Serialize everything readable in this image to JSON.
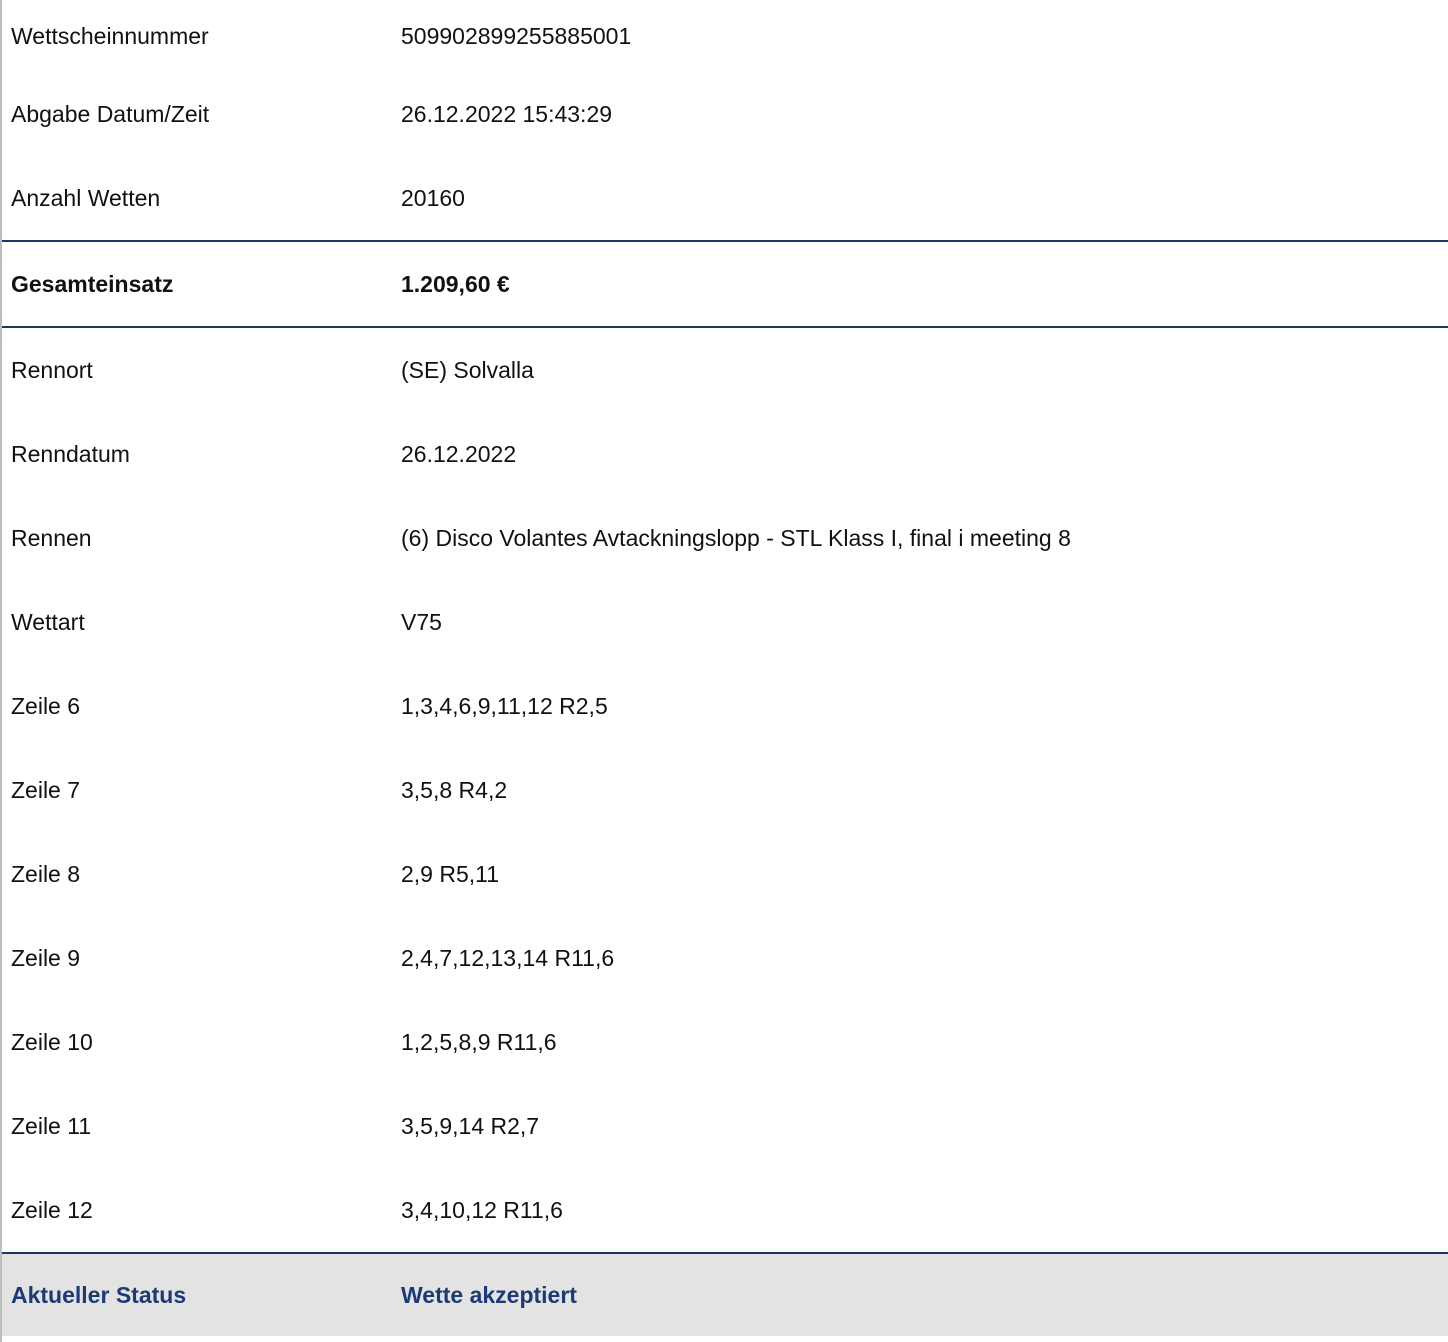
{
  "header_rows": [
    {
      "label": "Wettscheinnummer",
      "value": "509902899255885001"
    },
    {
      "label": "Abgabe Datum/Zeit",
      "value": "26.12.2022 15:43:29"
    },
    {
      "label": "Anzahl Wetten",
      "value": "20160"
    }
  ],
  "total": {
    "label": "Gesamteinsatz",
    "value": "1.209,60 €"
  },
  "detail_rows": [
    {
      "label": "Rennort",
      "value": "(SE) Solvalla"
    },
    {
      "label": "Renndatum",
      "value": "26.12.2022"
    },
    {
      "label": "Rennen",
      "value": "(6) Disco Volantes Avtackningslopp - STL Klass I, final i meeting 8"
    },
    {
      "label": "Wettart",
      "value": "V75"
    },
    {
      "label": "Zeile 6",
      "value": "1,3,4,6,9,11,12 R2,5"
    },
    {
      "label": "Zeile 7",
      "value": "3,5,8 R4,2"
    },
    {
      "label": "Zeile 8",
      "value": "2,9 R5,11"
    },
    {
      "label": "Zeile 9",
      "value": "2,4,7,12,13,14 R11,6"
    },
    {
      "label": "Zeile 10",
      "value": "1,2,5,8,9 R11,6"
    },
    {
      "label": "Zeile 11",
      "value": "3,5,9,14 R2,7"
    },
    {
      "label": "Zeile 12",
      "value": "3,4,10,12 R11,6"
    }
  ],
  "status": {
    "label": "Aktueller Status",
    "value": "Wette akzeptiert"
  },
  "colors": {
    "divider": "#1e3461",
    "status_text": "#1e3a74",
    "status_background": "#e3e3e3"
  }
}
